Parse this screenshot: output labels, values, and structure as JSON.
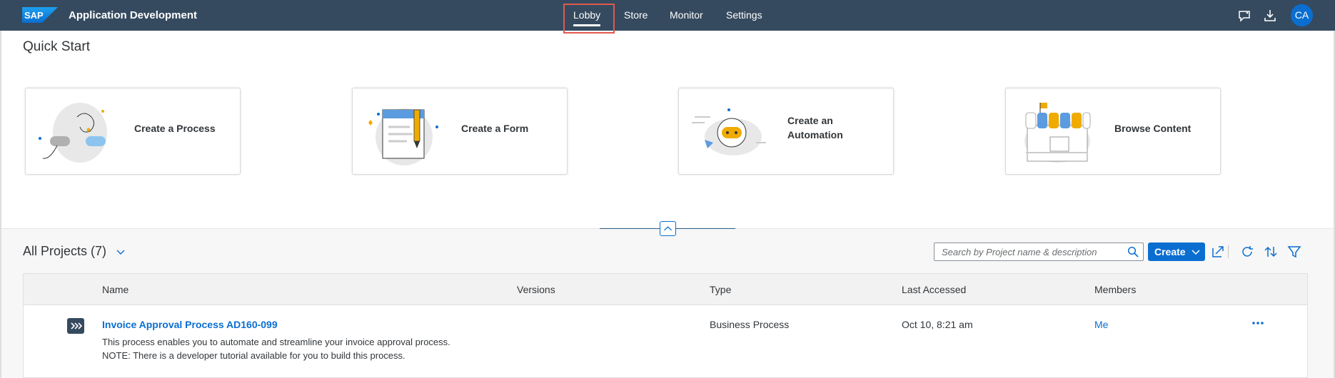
{
  "header": {
    "brand": "SAP",
    "app_title": "Application Development",
    "nav": [
      "Lobby",
      "Store",
      "Monitor",
      "Settings"
    ],
    "active_nav": "Lobby",
    "user_initials": "CA",
    "icons": [
      "feedback-icon",
      "download-icon"
    ]
  },
  "quick_start": {
    "title": "Quick Start",
    "cards": [
      {
        "label_1": "Create a Process",
        "label_2": ""
      },
      {
        "label_1": "Create a Form",
        "label_2": ""
      },
      {
        "label_1": "Create an",
        "label_2": "Automation"
      },
      {
        "label_1": "Browse Content",
        "label_2": ""
      }
    ]
  },
  "projects": {
    "title": "All Projects (7)",
    "search_placeholder": "Search by Project name & description",
    "create_label": "Create",
    "columns": [
      "Name",
      "Versions",
      "Type",
      "Last Accessed",
      "Members"
    ],
    "rows": [
      {
        "name": "Invoice Approval Process AD160-099",
        "description_1": "This process enables you to automate and streamline your invoice approval process.",
        "description_2": "NOTE: There is a developer tutorial available for you to build this process.",
        "versions": "",
        "type": "Business Process",
        "last_accessed": "Oct 10, 8:21 am",
        "members": "Me"
      }
    ]
  },
  "colors": {
    "shell": "#354a5f",
    "accent": "#0a6ed1",
    "highlight": "#e05a4c"
  }
}
